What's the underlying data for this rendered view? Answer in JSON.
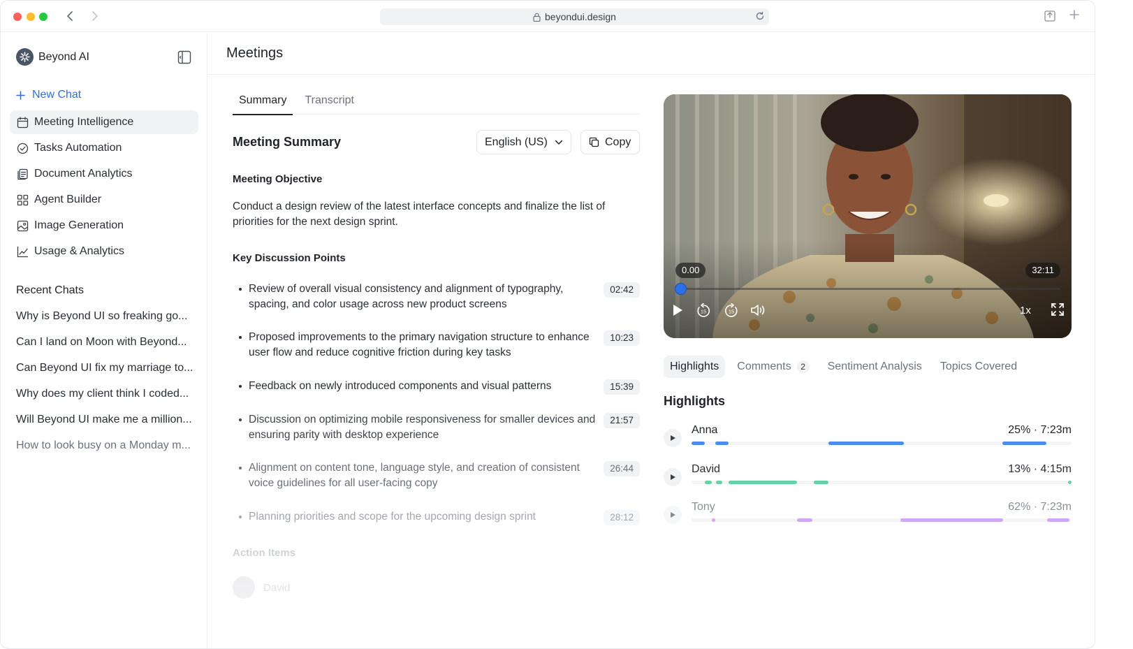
{
  "browser": {
    "url": "beyondui.design"
  },
  "sidebar": {
    "brand": "Beyond AI",
    "new_chat": "New Chat",
    "items": [
      {
        "label": "Meeting Intelligence",
        "icon": "calendar-icon",
        "active": true
      },
      {
        "label": "Tasks Automation",
        "icon": "check-circle-icon",
        "active": false
      },
      {
        "label": "Document Analytics",
        "icon": "document-icon",
        "active": false
      },
      {
        "label": "Agent Builder",
        "icon": "grid-icon",
        "active": false
      },
      {
        "label": "Image Generation",
        "icon": "image-icon",
        "active": false
      },
      {
        "label": "Usage & Analytics",
        "icon": "chart-icon",
        "active": false
      }
    ],
    "recent_title": "Recent Chats",
    "recent": [
      "Why is Beyond UI so freaking go...",
      "Can I land on Moon with Beyond...",
      "Can Beyond UI fix my marriage to...",
      "Why does my client think I coded...",
      "Will Beyond UI make me a million...",
      "How to look busy on a Monday m..."
    ]
  },
  "header": {
    "title": "Meetings"
  },
  "summary": {
    "tabs": [
      {
        "label": "Summary",
        "active": true
      },
      {
        "label": "Transcript",
        "active": false
      }
    ],
    "title": "Meeting Summary",
    "language": "English (US)",
    "copy_label": "Copy",
    "objective_heading": "Meeting Objective",
    "objective_text": "Conduct a design review of the latest interface concepts and finalize the list of priorities for the next design sprint.",
    "points_heading": "Key Discussion Points",
    "points": [
      {
        "text": "Review of overall visual consistency and alignment of typography, spacing, and color usage across new product screens",
        "time": "02:42"
      },
      {
        "text": "Proposed improvements to the primary navigation structure to enhance user flow and reduce cognitive friction during key tasks",
        "time": "10:23"
      },
      {
        "text": "Feedback on newly introduced components and visual patterns",
        "time": "15:39"
      },
      {
        "text": "Discussion on optimizing mobile responsiveness for smaller devices and ensuring parity with desktop experience",
        "time": "21:57"
      },
      {
        "text": "Alignment on content tone, language style, and creation of consistent voice guidelines for all user-facing copy",
        "time": "26:44"
      },
      {
        "text": "Planning priorities and scope for the upcoming design sprint",
        "time": "28:12"
      }
    ],
    "action_heading": "Action Items",
    "action_first_name": "David"
  },
  "video": {
    "current_time": "0.00",
    "total_time": "32:11",
    "progress": 0.0,
    "speed": "1x",
    "skip_back": "15",
    "skip_forward": "15"
  },
  "insights": {
    "tabs": [
      {
        "label": "Highlights",
        "active": true,
        "badge": ""
      },
      {
        "label": "Comments",
        "active": false,
        "badge": "2"
      },
      {
        "label": "Sentiment Analysis",
        "active": false,
        "badge": ""
      },
      {
        "label": "Topics Covered",
        "active": false,
        "badge": ""
      }
    ],
    "heading": "Highlights",
    "speakers": [
      {
        "name": "Anna",
        "stat": "25% · 7:23m",
        "color": "#4b8cf0",
        "segments": [
          [
            0.0,
            0.035
          ],
          [
            0.062,
            0.097
          ],
          [
            0.36,
            0.558
          ],
          [
            0.818,
            0.933
          ]
        ]
      },
      {
        "name": "David",
        "stat": "13% · 4:15m",
        "color": "#66d1a4",
        "segments": [
          [
            0.035,
            0.053
          ],
          [
            0.064,
            0.08
          ],
          [
            0.097,
            0.277
          ],
          [
            0.322,
            0.361
          ],
          [
            0.991,
            1.0
          ]
        ]
      },
      {
        "name": "Tony",
        "stat": "62% · 7:23m",
        "color": "#cfa8f5",
        "segments": [
          [
            0.053,
            0.062
          ],
          [
            0.277,
            0.318
          ],
          [
            0.55,
            0.82
          ],
          [
            0.935,
            0.995
          ]
        ]
      }
    ]
  },
  "colors": {
    "accent": "#2f6fe4",
    "active_bg": "#f1f2f4",
    "border": "#eceef1"
  }
}
